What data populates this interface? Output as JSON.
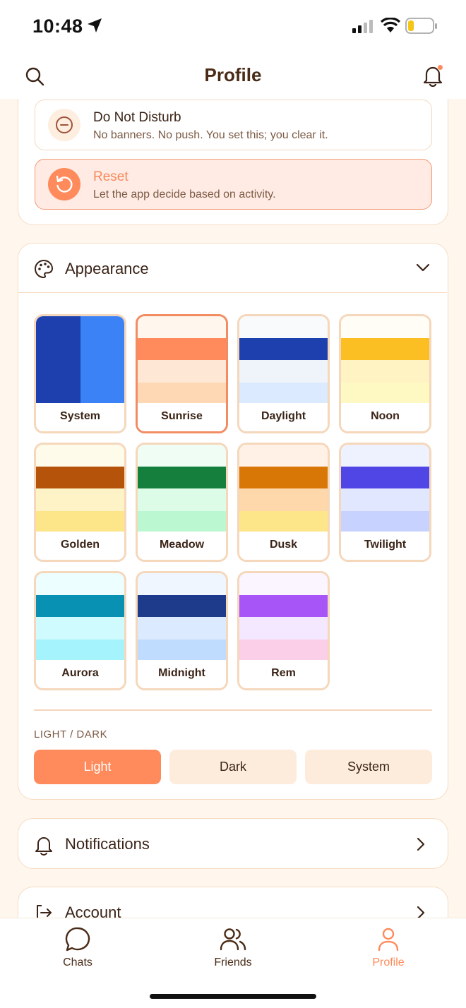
{
  "status_bar": {
    "time": "10:48"
  },
  "header": {
    "title": "Profile"
  },
  "focus_options": [
    {
      "title": "Do Not Disturb",
      "description": "No banners. No push. You set this; you clear it.",
      "icon": "minus-circle-icon"
    },
    {
      "title": "Reset",
      "description": "Let the app decide based on activity.",
      "icon": "reset-icon"
    }
  ],
  "appearance": {
    "title": "Appearance",
    "themes": [
      {
        "name": "System",
        "selected": false
      },
      {
        "name": "Sunrise",
        "selected": true
      },
      {
        "name": "Daylight",
        "selected": false
      },
      {
        "name": "Noon",
        "selected": false
      },
      {
        "name": "Golden",
        "selected": false
      },
      {
        "name": "Meadow",
        "selected": false
      },
      {
        "name": "Dusk",
        "selected": false
      },
      {
        "name": "Twilight",
        "selected": false
      },
      {
        "name": "Aurora",
        "selected": false
      },
      {
        "name": "Midnight",
        "selected": false
      },
      {
        "name": "Rem",
        "selected": false
      }
    ],
    "mode_label": "LIGHT / DARK",
    "modes": [
      {
        "label": "Light",
        "active": true
      },
      {
        "label": "Dark",
        "active": false
      },
      {
        "label": "System",
        "active": false
      }
    ]
  },
  "sections": [
    {
      "title": "Notifications",
      "icon": "bell-icon"
    },
    {
      "title": "Account",
      "icon": "logout-icon"
    }
  ],
  "tabs": [
    {
      "label": "Chats",
      "icon": "chat-bubble-icon",
      "active": false
    },
    {
      "label": "Friends",
      "icon": "users-icon",
      "active": false
    },
    {
      "label": "Profile",
      "icon": "user-icon",
      "active": true
    }
  ],
  "colors": {
    "accent": "#ff8a5b",
    "border": "#f6dcc3",
    "background": "#fff7ed"
  }
}
